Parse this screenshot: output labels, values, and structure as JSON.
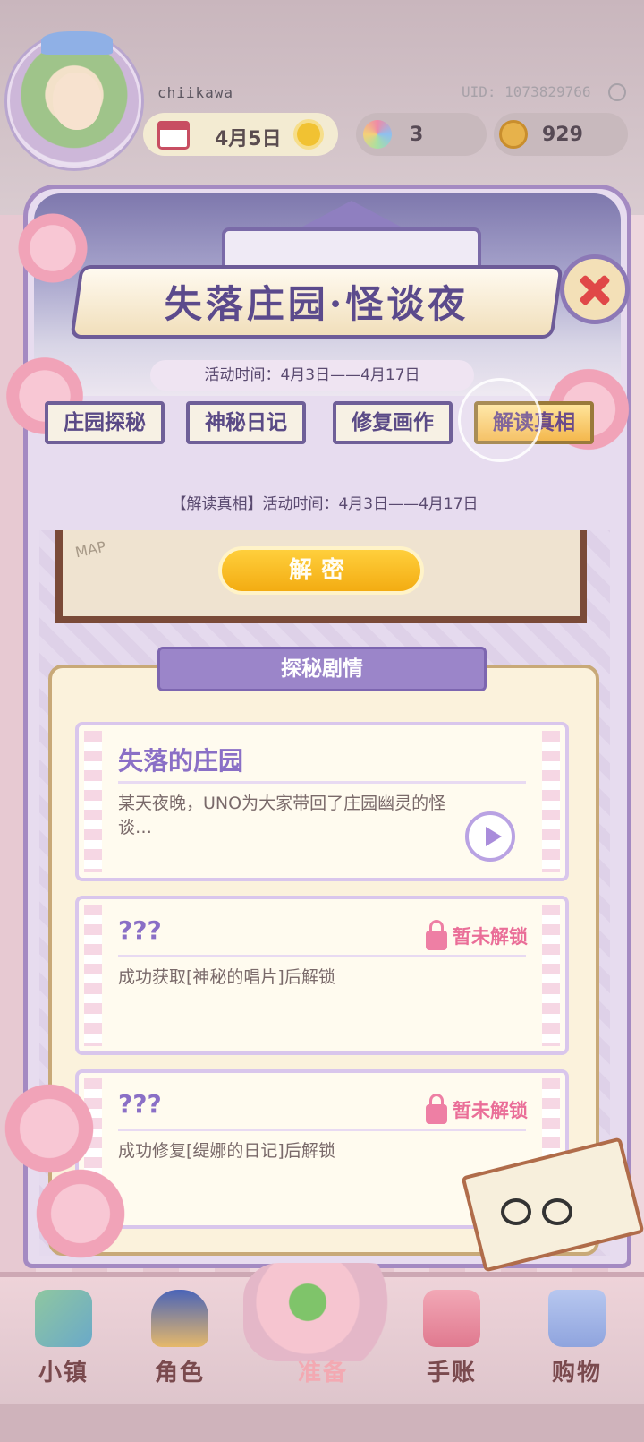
{
  "header": {
    "username": "chiikawa",
    "uid": "UID: 1073829766",
    "date": "4月5日",
    "flower_count": "3",
    "coin_count": "929"
  },
  "event": {
    "title": "失落庄园·怪谈夜",
    "time": "活动时间：4月3日——4月17日"
  },
  "tabs": [
    {
      "label": "庄园探秘",
      "active": false
    },
    {
      "label": "神秘日记",
      "active": false
    },
    {
      "label": "修复画作",
      "active": false
    },
    {
      "label": "解读真相",
      "active": true
    }
  ],
  "subsection": {
    "time": "【解读真相】活动时间：4月3日——4月17日",
    "map_label": "MAP",
    "decrypt_label": "解密"
  },
  "story": {
    "section_title": "探秘剧情",
    "cards": [
      {
        "title": "失落的庄园",
        "desc": "某天夜晚，UNO为大家带回了庄园幽灵的怪谈…",
        "locked": false
      },
      {
        "title": "???",
        "desc": "成功获取[神秘的唱片]后解锁",
        "locked": true,
        "lock_label": "暂未解锁"
      },
      {
        "title": "???",
        "desc": "成功修复[缇娜的日记]后解锁",
        "locked": true,
        "lock_label": "暂未解锁"
      }
    ]
  },
  "nav": [
    {
      "label": "小镇",
      "icon": "map-icon"
    },
    {
      "label": "角色",
      "icon": "character-icon"
    },
    {
      "label": "准备",
      "icon": "prepare-icon"
    },
    {
      "label": "手账",
      "icon": "journal-icon"
    },
    {
      "label": "购物",
      "icon": "shopping-bag-icon"
    }
  ],
  "colors": {
    "accent_purple": "#8a6fc6",
    "lock_pink": "#ea6e98",
    "decrypt_gold": "#f3ac12"
  }
}
